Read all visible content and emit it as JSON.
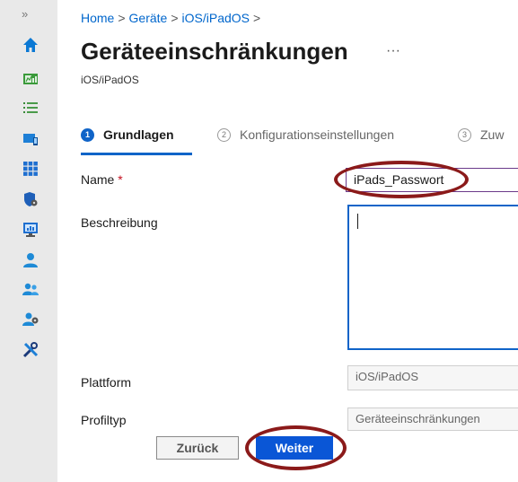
{
  "sidebar": {
    "expand_glyph": "»",
    "icons": [
      "home-icon",
      "dashboard-icon",
      "list-icon",
      "devices-icon",
      "apps-icon",
      "endpoint-security-icon",
      "reports-icon",
      "users-icon",
      "groups-icon",
      "tenant-admin-icon",
      "troubleshooting-icon"
    ]
  },
  "breadcrumb": {
    "items": [
      "Home",
      "Geräte",
      "iOS/iPadOS"
    ],
    "separator": ">"
  },
  "page": {
    "title": "Geräteeinschränkungen",
    "more": "···",
    "subtitle": "iOS/iPadOS"
  },
  "steps": [
    {
      "number": "1",
      "label": "Grundlagen",
      "active": true
    },
    {
      "number": "2",
      "label": "Konfigurationseinstellungen",
      "active": false
    },
    {
      "number": "3",
      "label": "Zuw",
      "active": false
    }
  ],
  "form": {
    "name": {
      "label": "Name",
      "required_marker": "*",
      "value": "iPads_Passwort"
    },
    "description": {
      "label": "Beschreibung",
      "value": ""
    },
    "platform": {
      "label": "Plattform",
      "value": "iOS/iPadOS"
    },
    "profile_type": {
      "label": "Profiltyp",
      "value": "Geräteeinschränkungen"
    }
  },
  "buttons": {
    "back_label": "Zurück",
    "next_label": "Weiter"
  },
  "colors": {
    "accent": "#1064c8",
    "primary_button": "#0a56d6",
    "annotation": "#8b1a1a",
    "required": "#c50f1f"
  }
}
